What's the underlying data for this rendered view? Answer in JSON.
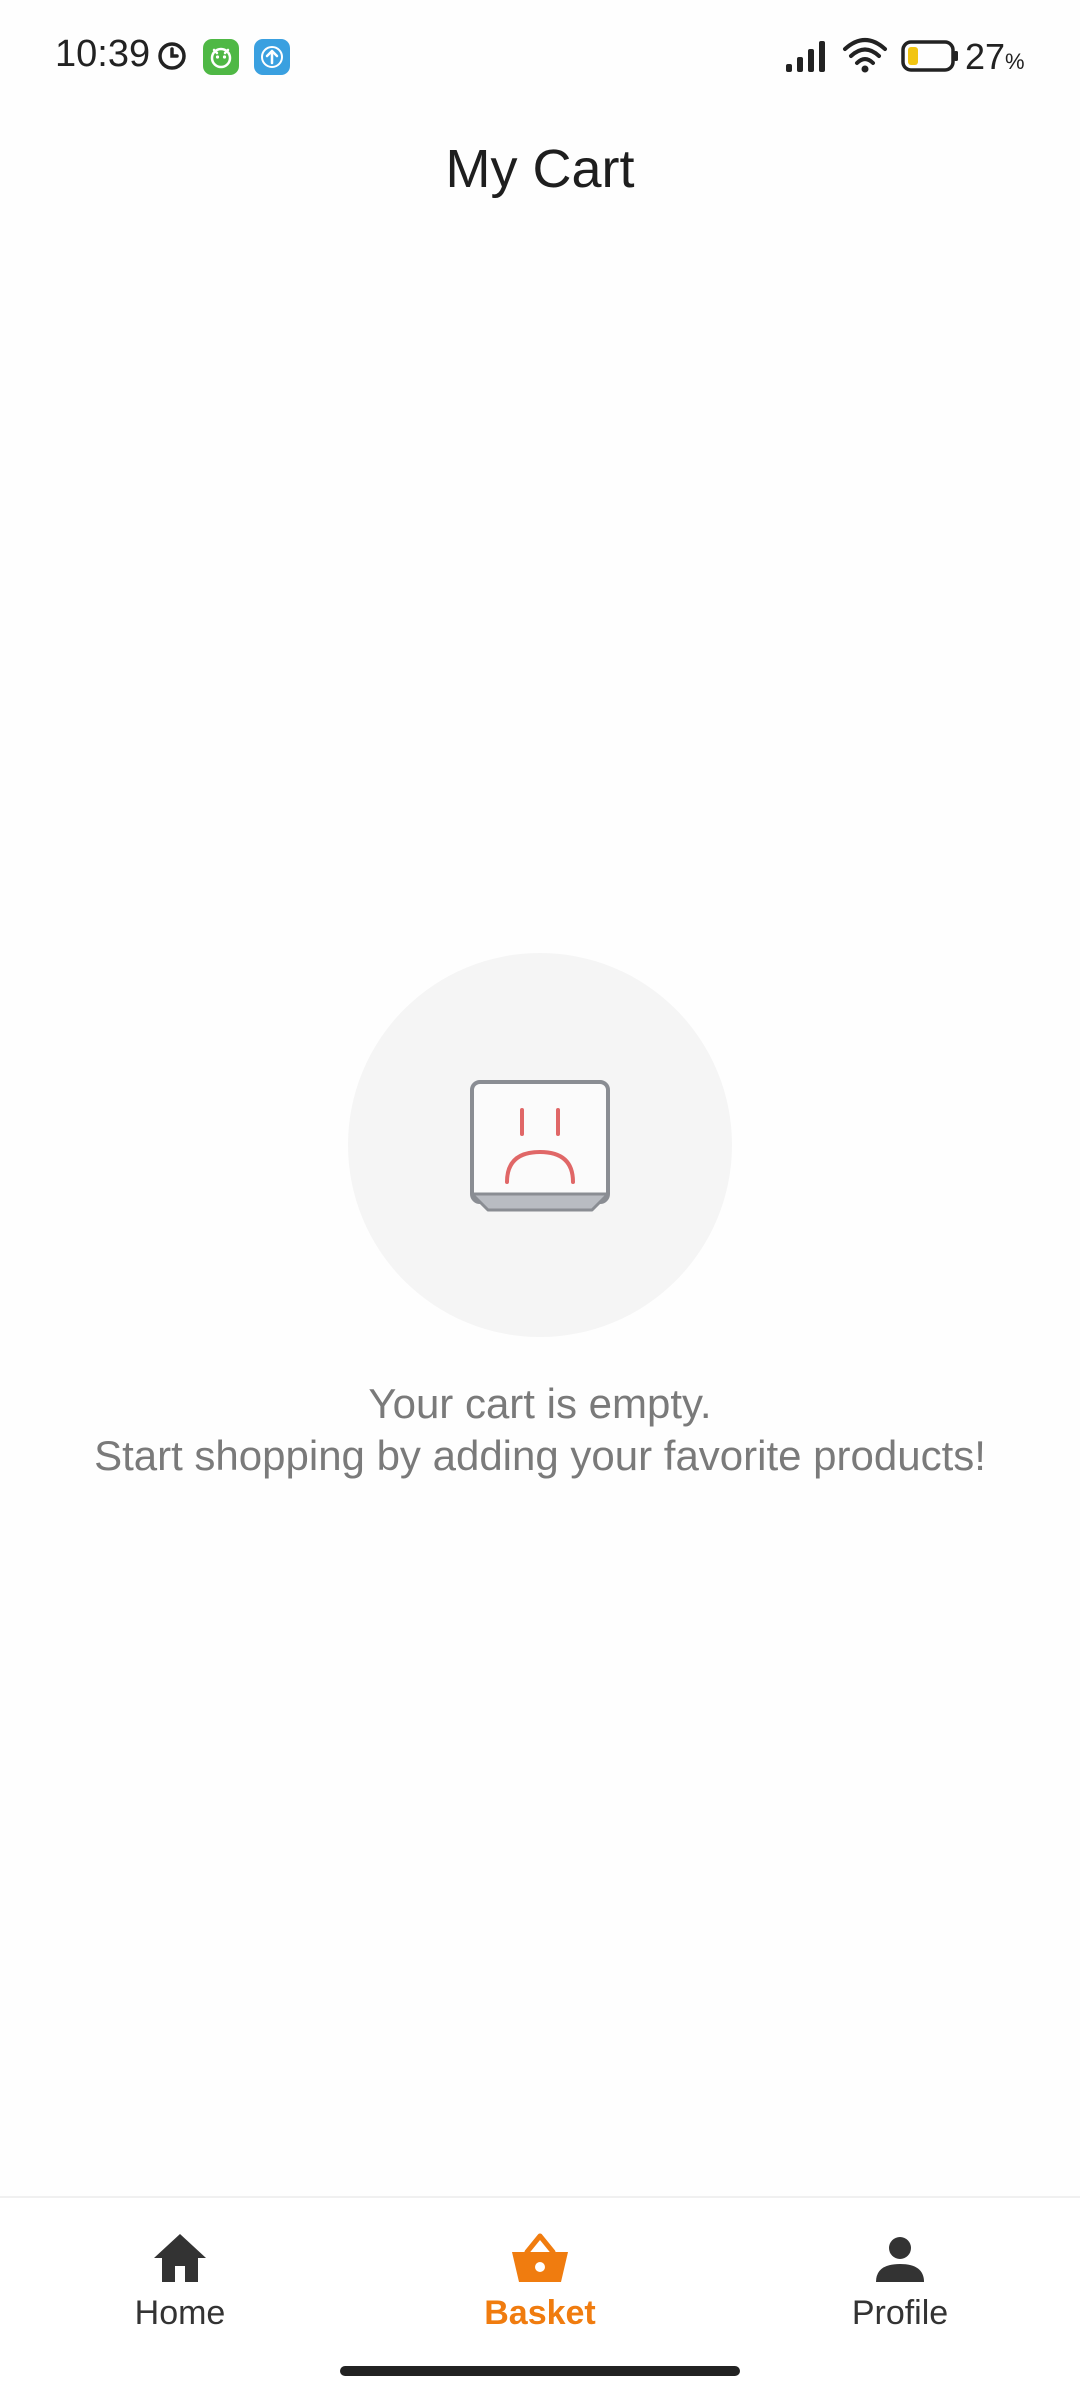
{
  "status_bar": {
    "time": "10:39",
    "battery_level": "27",
    "battery_unit": "%",
    "icons": [
      "clock-icon",
      "app-icon-green",
      "app-icon-blue",
      "signal-icon",
      "wifi-icon",
      "battery-icon"
    ]
  },
  "header": {
    "title": "My Cart"
  },
  "empty_state": {
    "icon": "sad-box-icon",
    "line1": "Your cart is empty.",
    "line2": "Start shopping by adding your favorite products!"
  },
  "bottom_nav": {
    "active": "basket",
    "accent_color": "#f07c0f",
    "items": [
      {
        "id": "home",
        "label": "Home",
        "icon": "home-icon"
      },
      {
        "id": "basket",
        "label": "Basket",
        "icon": "basket-icon"
      },
      {
        "id": "profile",
        "label": "Profile",
        "icon": "person-icon"
      }
    ]
  }
}
